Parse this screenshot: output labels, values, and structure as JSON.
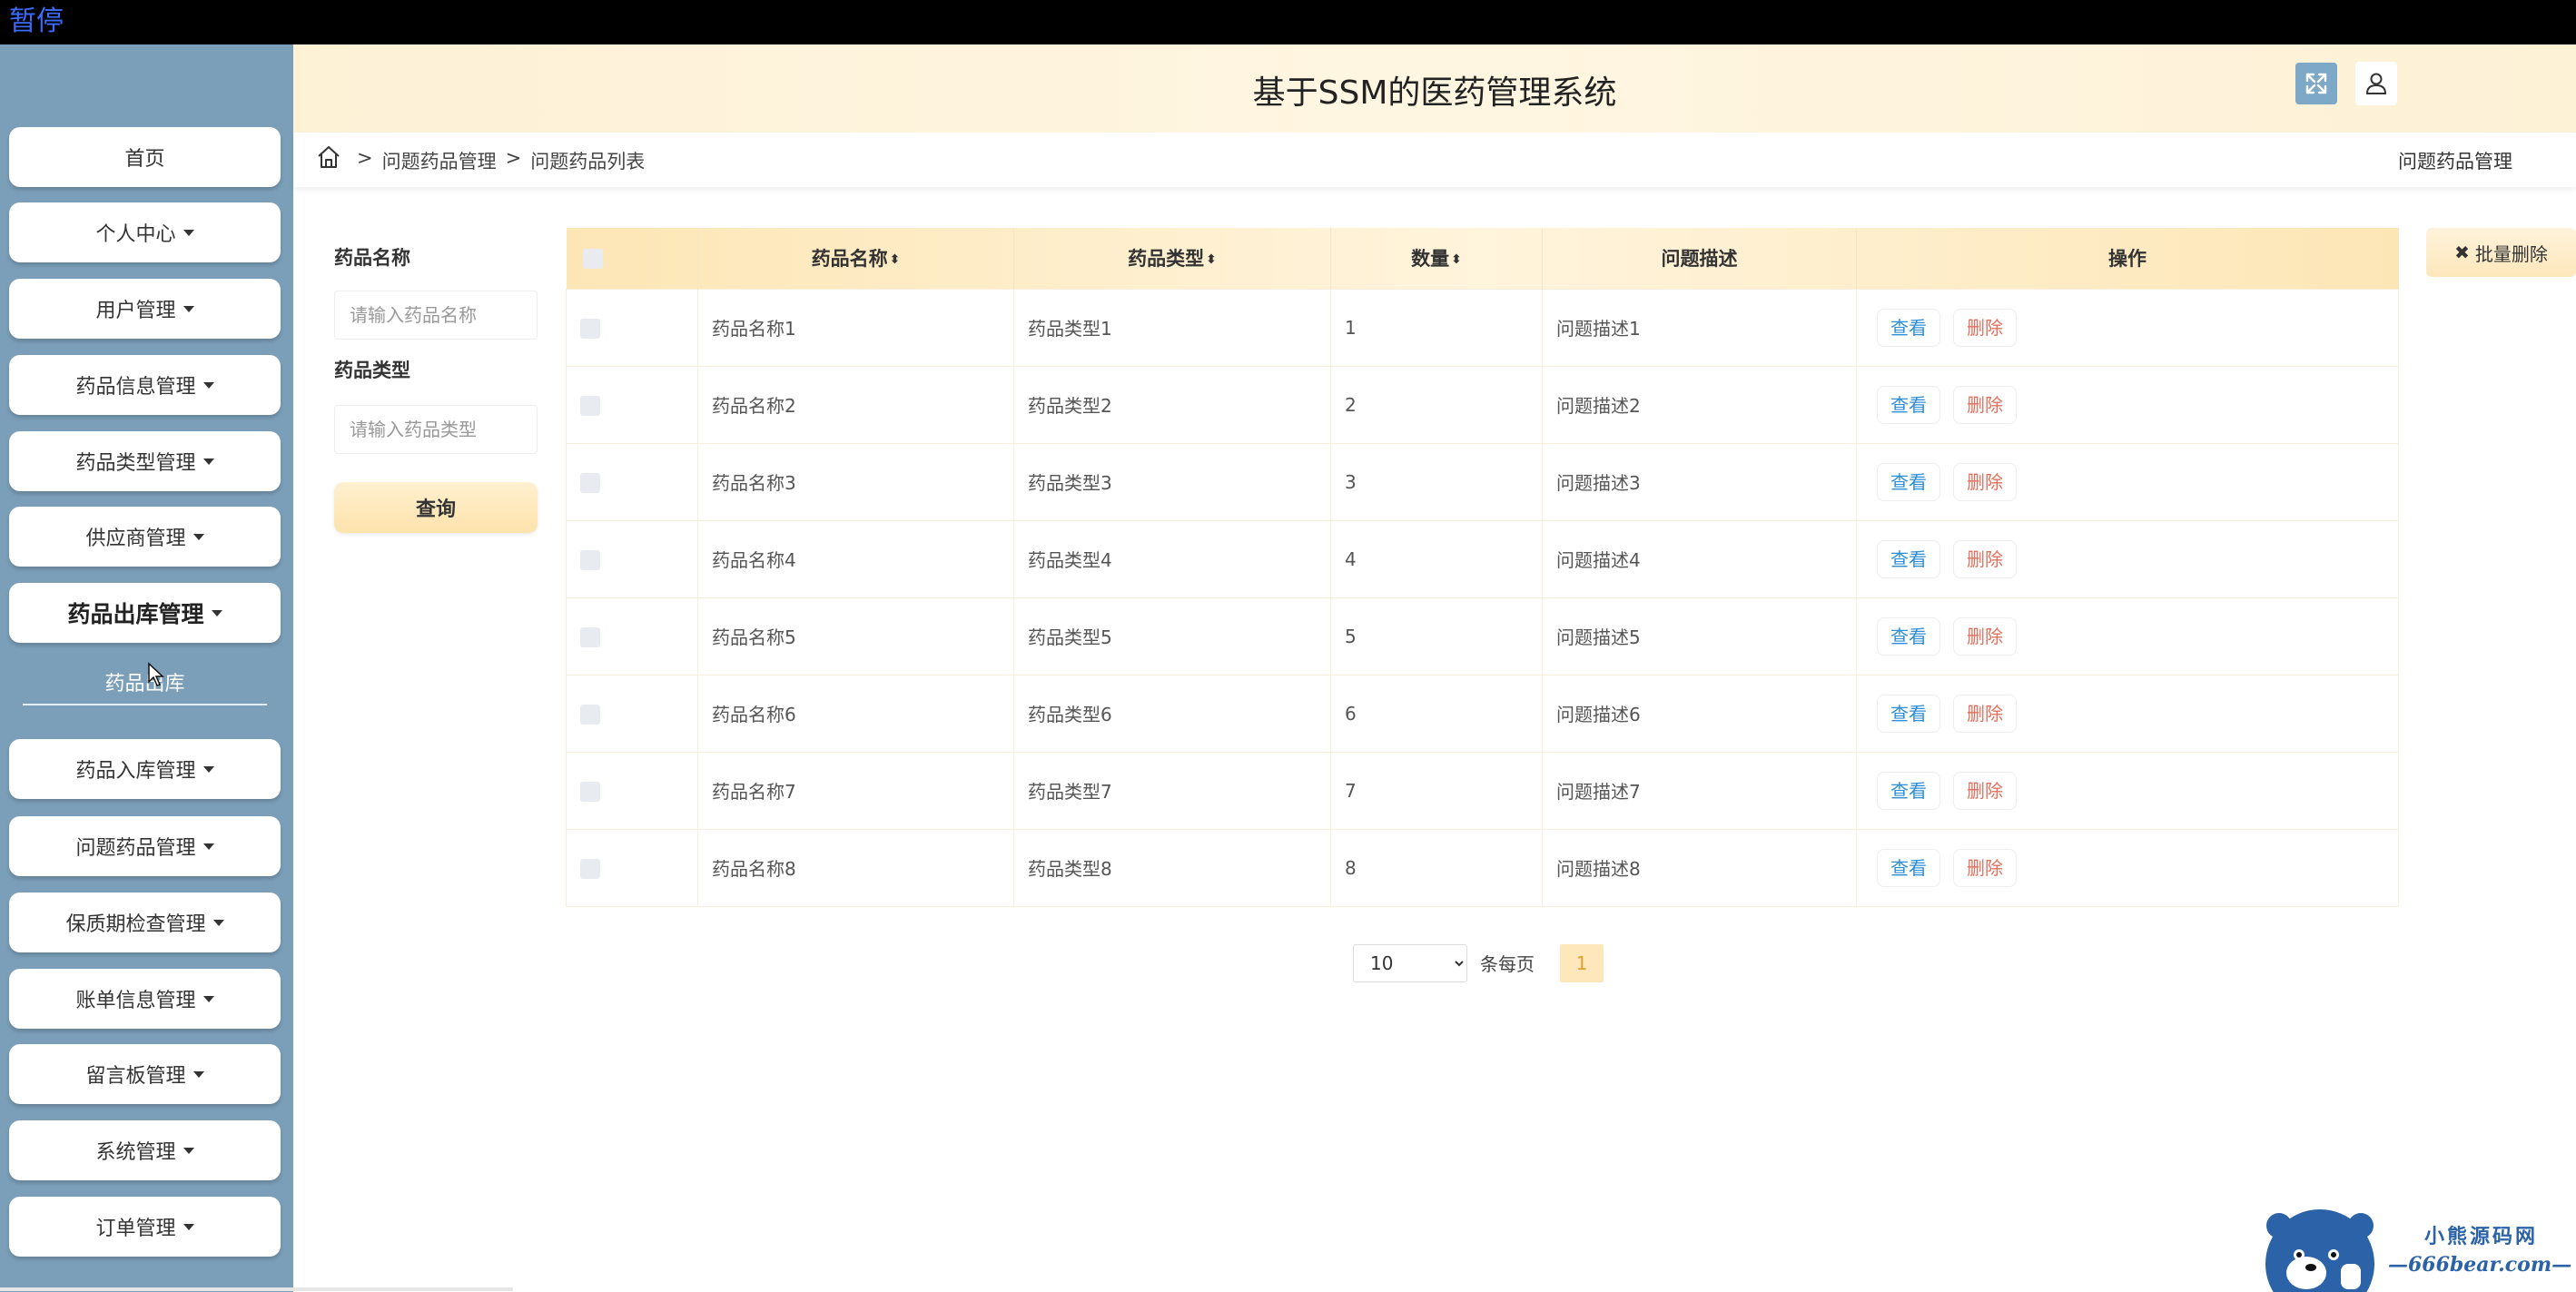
{
  "top_bar": {
    "pause_label": "暂停"
  },
  "header": {
    "title": "基于SSM的医药管理系统"
  },
  "sidebar": {
    "items": [
      {
        "label": "首页",
        "has_caret": false
      },
      {
        "label": "个人中心",
        "has_caret": true
      },
      {
        "label": "用户管理",
        "has_caret": true
      },
      {
        "label": "药品信息管理",
        "has_caret": true
      },
      {
        "label": "药品类型管理",
        "has_caret": true
      },
      {
        "label": "供应商管理",
        "has_caret": true
      },
      {
        "label": "药品出库管理",
        "has_caret": true
      },
      {
        "label": "药品入库管理",
        "has_caret": true
      },
      {
        "label": "问题药品管理",
        "has_caret": true
      },
      {
        "label": "保质期检查管理",
        "has_caret": true
      },
      {
        "label": "账单信息管理",
        "has_caret": true
      },
      {
        "label": "留言板管理",
        "has_caret": true
      },
      {
        "label": "系统管理",
        "has_caret": true
      },
      {
        "label": "订单管理",
        "has_caret": true
      }
    ],
    "sub_item": "药品出库"
  },
  "breadcrumb": {
    "items": [
      "问题药品管理",
      "问题药品列表"
    ],
    "separator": ">",
    "right_title": "问题药品管理"
  },
  "search": {
    "name_label": "药品名称",
    "name_placeholder": "请输入药品名称",
    "type_label": "药品类型",
    "type_placeholder": "请输入药品类型",
    "query_button": "查询"
  },
  "table": {
    "headers": [
      "药品名称",
      "药品类型",
      "数量",
      "问题描述",
      "操作"
    ],
    "sortable": [
      true,
      true,
      true,
      false,
      false
    ],
    "rows": [
      {
        "name": "药品名称1",
        "type": "药品类型1",
        "qty": "1",
        "desc": "问题描述1"
      },
      {
        "name": "药品名称2",
        "type": "药品类型2",
        "qty": "2",
        "desc": "问题描述2"
      },
      {
        "name": "药品名称3",
        "type": "药品类型3",
        "qty": "3",
        "desc": "问题描述3"
      },
      {
        "name": "药品名称4",
        "type": "药品类型4",
        "qty": "4",
        "desc": "问题描述4"
      },
      {
        "name": "药品名称5",
        "type": "药品类型5",
        "qty": "5",
        "desc": "问题描述5"
      },
      {
        "name": "药品名称6",
        "type": "药品类型6",
        "qty": "6",
        "desc": "问题描述6"
      },
      {
        "name": "药品名称7",
        "type": "药品类型7",
        "qty": "7",
        "desc": "问题描述7"
      },
      {
        "name": "药品名称8",
        "type": "药品类型8",
        "qty": "8",
        "desc": "问题描述8"
      }
    ],
    "view_label": "查看",
    "delete_label": "删除"
  },
  "batch_delete": {
    "label": "批量删除"
  },
  "pagination": {
    "page_size": "10",
    "page_size_options": [
      "10"
    ],
    "per_page_label": "条每页",
    "current_page": "1"
  },
  "logo": {
    "top_text": "小熊源码网",
    "bottom_text": "—666bear.com—"
  },
  "colors": {
    "sidebar_bg": "#7b9fb9",
    "header_bg": "#fdf1d6",
    "view_color": "#2f8ed6",
    "delete_color": "#e0705c",
    "accent": "#fde7bb"
  }
}
